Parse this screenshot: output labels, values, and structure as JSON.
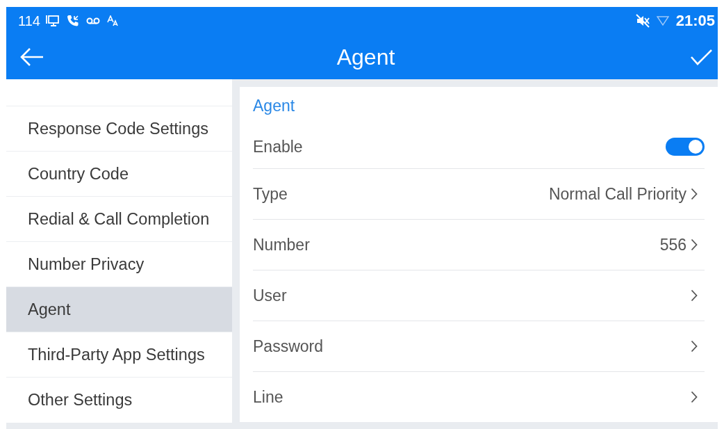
{
  "status_bar": {
    "extension": "114",
    "time": "21:05"
  },
  "title_bar": {
    "title": "Agent"
  },
  "sidebar": {
    "items": [
      {
        "label": "Response Code Settings",
        "selected": false
      },
      {
        "label": "Country Code",
        "selected": false
      },
      {
        "label": "Redial & Call Completion",
        "selected": false
      },
      {
        "label": "Number Privacy",
        "selected": false
      },
      {
        "label": "Agent",
        "selected": true
      },
      {
        "label": "Third-Party App Settings",
        "selected": false
      },
      {
        "label": "Other Settings",
        "selected": false
      }
    ]
  },
  "panel": {
    "section_title": "Agent",
    "rows": [
      {
        "kind": "toggle",
        "label": "Enable",
        "on": true
      },
      {
        "kind": "link",
        "label": "Type",
        "value": "Normal Call Priority"
      },
      {
        "kind": "link",
        "label": "Number",
        "value": "556"
      },
      {
        "kind": "link",
        "label": "User"
      },
      {
        "kind": "link",
        "label": "Password"
      },
      {
        "kind": "link",
        "label": "Line"
      }
    ]
  }
}
